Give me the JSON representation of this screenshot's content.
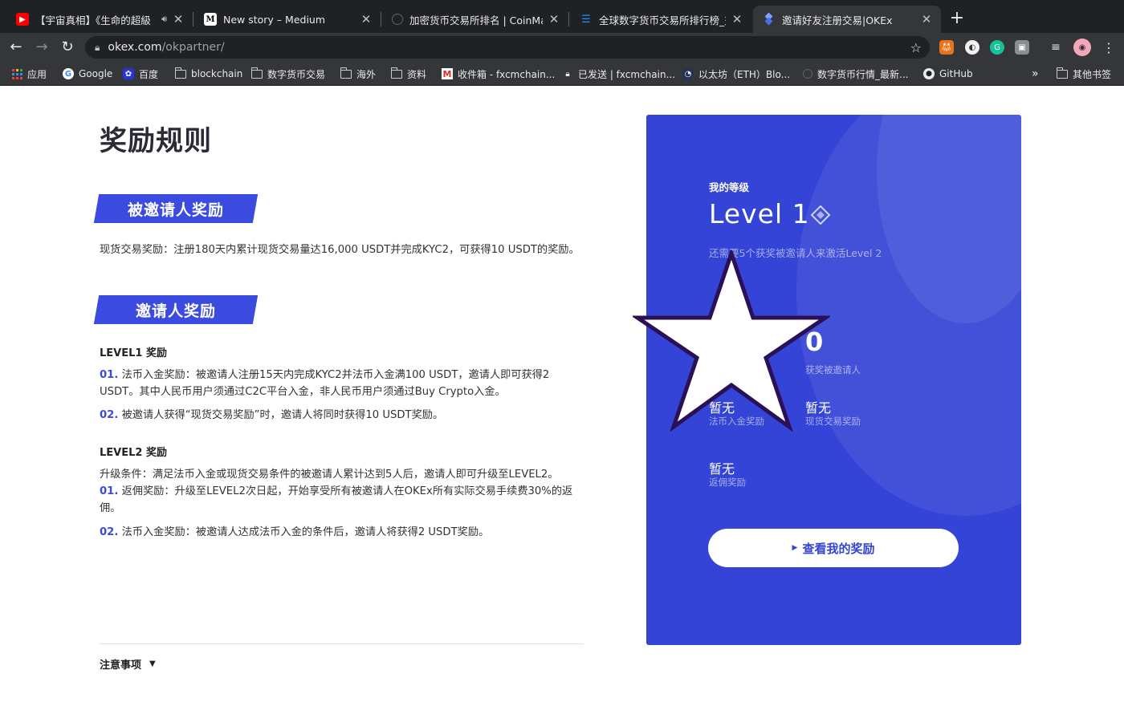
{
  "browser": {
    "tabs": [
      {
        "title": "【宇宙真相】《生命的超級",
        "favicon": "youtube-icon",
        "favicon_color": "#ff0000",
        "audio": true
      },
      {
        "title": "New story – Medium",
        "favicon": "medium-icon",
        "favicon_color": "#ffffff"
      },
      {
        "title": "加密货币交易所排名 | CoinMarke",
        "favicon": "coinmarketcap-icon",
        "favicon_color": "#5f6368"
      },
      {
        "title": "全球数字货币交易所排行榜_交易",
        "favicon": "feixiaohao-icon",
        "favicon_color": "#1e90ff"
      },
      {
        "title": "邀请好友注册交易|OKEx",
        "favicon": "okex-icon",
        "favicon_color": "#5b7cf5",
        "active": true
      }
    ],
    "url_host": "okex.com",
    "url_path": "/okpartner/",
    "bookmarks": [
      {
        "label": "应用",
        "icon": "apps-grid-icon"
      },
      {
        "label": "Google",
        "icon": "google-icon"
      },
      {
        "label": "百度",
        "icon": "baidu-icon"
      },
      {
        "label": "blockchain",
        "icon": "folder-icon"
      },
      {
        "label": "数字货币交易",
        "icon": "folder-icon"
      },
      {
        "label": "海外",
        "icon": "folder-icon"
      },
      {
        "label": "资料",
        "icon": "folder-icon"
      },
      {
        "label": "收件箱 - fxcmchain...",
        "icon": "gmail-icon"
      },
      {
        "label": "已发送 | fxcmchain...",
        "icon": "protonmail-icon"
      },
      {
        "label": "以太坊（ETH）Blo...",
        "icon": "etherscan-icon"
      },
      {
        "label": "数字货币行情_最新...",
        "icon": "coinmarket-icon"
      },
      {
        "label": "GitHub",
        "icon": "github-icon"
      }
    ],
    "bookmarks_overflow": "»",
    "other_bookmarks": "其他书签"
  },
  "page": {
    "title": "奖励规则",
    "invitee_section": {
      "heading": "被邀请人奖励",
      "text": "现货交易奖励：注册180天内累计现货交易量达16,000 USDT并完成KYC2，可获得10 USDT的奖励。"
    },
    "inviter_section": {
      "heading": "邀请人奖励",
      "level1_title": "LEVEL1 奖励",
      "level1_items": [
        {
          "num": "01.",
          "text": "法币入金奖励：被邀请人注册15天内完成KYC2并法币入金满100 USDT，邀请人即可获得2 USDT。其中人民币用户须通过C2C平台入金，非人民币用户须通过Buy Crypto入金。"
        },
        {
          "num": "02.",
          "text": "被邀请人获得“现货交易奖励”时，邀请人将同时获得10 USDT奖励。"
        }
      ],
      "level2_title": "LEVEL2 奖励",
      "level2_condition": "升级条件：满足法币入金或现货交易条件的被邀请人累计达到5人后，邀请人即可升级至LEVEL2。",
      "level2_items": [
        {
          "num": "01.",
          "text": "返佣奖励：升级至LEVEL2次日起，开始享受所有被邀请人在OKEx所有实际交易手续费30%的返佣。"
        },
        {
          "num": "02.",
          "text": "法币入金奖励：被邀请人达成法币入金的条件后，邀请人将获得2 USDT奖励。"
        }
      ]
    },
    "notice": "注意事项"
  },
  "card": {
    "level_label": "我的等级",
    "level_value": "Level 1",
    "hint": "还需要5个获奖被邀请人来激活Level 2",
    "invitees_count": "0",
    "invitees_label": "获奖被邀请人",
    "fiat_reward_value": "暂无",
    "fiat_reward_label": "法币入金奖励",
    "spot_reward_value": "暂无",
    "spot_reward_label": "现货交易奖励",
    "rebate_value": "暂无",
    "rebate_label": "返佣奖励",
    "button_label": "查看我的奖励",
    "color": "#3444d6"
  }
}
